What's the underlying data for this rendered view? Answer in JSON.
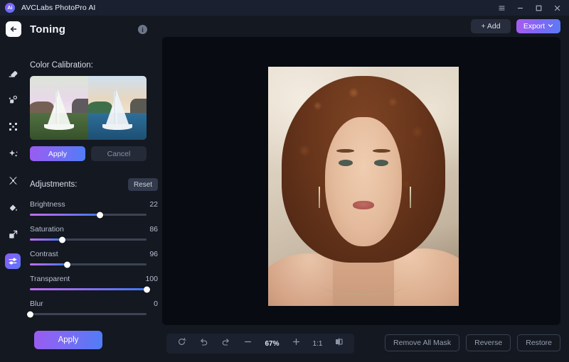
{
  "titlebar": {
    "app_name": "AVCLabs PhotoPro AI",
    "logo_text": "Ai",
    "menu_icon": "hamburger-menu-icon",
    "minimize_icon": "minimize-icon",
    "maximize_icon": "maximize-icon",
    "close_icon": "close-icon"
  },
  "panel": {
    "title": "Toning",
    "back_icon": "back-arrow-icon",
    "info_icon": "info-icon",
    "info_glyph": "i"
  },
  "rail": {
    "items": [
      {
        "name": "erase-tool",
        "icon": "eraser-icon"
      },
      {
        "name": "ai-retouch-tool",
        "icon": "magic-wand-sparkle-icon"
      },
      {
        "name": "upscale-tool",
        "icon": "expand-corners-icon"
      },
      {
        "name": "enhance-tool",
        "icon": "sparkle-star-icon"
      },
      {
        "name": "background-tool",
        "icon": "four-petal-icon"
      },
      {
        "name": "color-fill-tool",
        "icon": "paint-bucket-icon"
      },
      {
        "name": "crop-resize-tool",
        "icon": "resize-arrow-icon"
      },
      {
        "name": "toning-tool",
        "icon": "sliders-icon",
        "active": true
      }
    ]
  },
  "color_calibration": {
    "label": "Color Calibration:",
    "preview_name": "sailboat-before-after-preview",
    "apply_label": "Apply",
    "cancel_label": "Cancel"
  },
  "adjustments": {
    "label": "Adjustments:",
    "reset_label": "Reset",
    "sliders": [
      {
        "name": "Brightness",
        "value": 22,
        "percent": 60
      },
      {
        "name": "Saturation",
        "value": 86,
        "percent": 28
      },
      {
        "name": "Contrast",
        "value": 96,
        "percent": 32
      },
      {
        "name": "Transparent",
        "value": 100,
        "percent": 100
      },
      {
        "name": "Blur",
        "value": 0,
        "percent": 0
      }
    ],
    "apply_label": "Apply"
  },
  "topbar": {
    "add_label": "+ Add",
    "export_label": "Export",
    "export_caret": "chevron-down-icon"
  },
  "canvas": {
    "photo_name": "portrait-photo"
  },
  "bottombar": {
    "tools": [
      {
        "name": "reset-view-button",
        "icon": "refresh-circle-icon"
      },
      {
        "name": "undo-button",
        "icon": "undo-arrow-icon"
      },
      {
        "name": "redo-button",
        "icon": "redo-arrow-icon"
      },
      {
        "name": "zoom-out-button",
        "icon": "minus-icon"
      }
    ],
    "zoom_level": "67%",
    "zoom_in": {
      "name": "zoom-in-button",
      "icon": "plus-icon"
    },
    "fit_ratio": "1:1",
    "compare_icon": "split-compare-icon",
    "remove_all_mask_label": "Remove All Mask",
    "reverse_label": "Reverse",
    "restore_label": "Restore"
  },
  "colors": {
    "accent_purple": "#8b5cf6",
    "accent_blue": "#4f7df6",
    "panel_bg": "#141821",
    "titlebar_bg": "#1b2030",
    "canvas_bg": "#080b11"
  }
}
